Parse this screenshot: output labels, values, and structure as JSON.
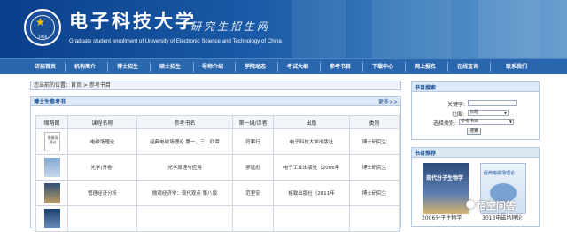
{
  "header": {
    "title_cn": "电子科技大学",
    "subtitle_cn": "研究生招生网",
    "title_en": "Graduate student enrollment of University of Electronic Science and Technology of China",
    "logo_year": "1956"
  },
  "nav": [
    "研招首页",
    "机构简介",
    "博士招生",
    "硕士招生",
    "导师介绍",
    "学院动态",
    "考试大纲",
    "参考书目",
    "下载中心",
    "网上报名",
    "在线查询",
    "联系我们"
  ],
  "breadcrumb": "您当前的位置：首页 > 参考书目",
  "main": {
    "panel_title": "博士生参考书",
    "more": "更多>>",
    "columns": [
      "缩略图",
      "课程名称",
      "参考书名",
      "第一编/译者",
      "出版",
      "类别"
    ],
    "rows": [
      {
        "thumb": "电磁场理论",
        "course": "电磁场理论",
        "book": "经典电磁场理论 第一、三、四章",
        "author": "符果行",
        "publisher": "电子科技大学出版社",
        "type": "博士研究生"
      },
      {
        "thumb": "",
        "course": "光学(开卷)",
        "book": "光学原理与应用",
        "author": "廖延彪",
        "publisher": "电子工业出版社（2006年",
        "type": "博士研究生"
      },
      {
        "thumb": "",
        "course": "管理经济分析",
        "book": "微观经济学：现代观点 第八版",
        "author": "范里安",
        "publisher": "格致出版社（2011年",
        "type": "博士研究生"
      },
      {
        "thumb": "",
        "course": "",
        "book": "",
        "author": "",
        "publisher": "",
        "type": ""
      }
    ]
  },
  "search": {
    "title": "书目搜索",
    "keyword_label": "关键字:",
    "keyword_value": "",
    "scope_label": "范围:",
    "scope_value": "标题",
    "category_label": "选择类别:",
    "category_value": "参考书目",
    "button": "搜索"
  },
  "recommend": {
    "title": "书目推荐",
    "books": [
      {
        "cover_title": "现代分子生物学",
        "caption": "2006分子生物学"
      },
      {
        "cover_title": "经典电磁场理论",
        "caption": "3013电磁场理论"
      }
    ]
  },
  "watermark": "悟空问答",
  "colors": {
    "nav": "#2a66ad",
    "header": "#0a3f8a",
    "panel_head": "#dde8f5",
    "accent": "#1a4f95"
  }
}
